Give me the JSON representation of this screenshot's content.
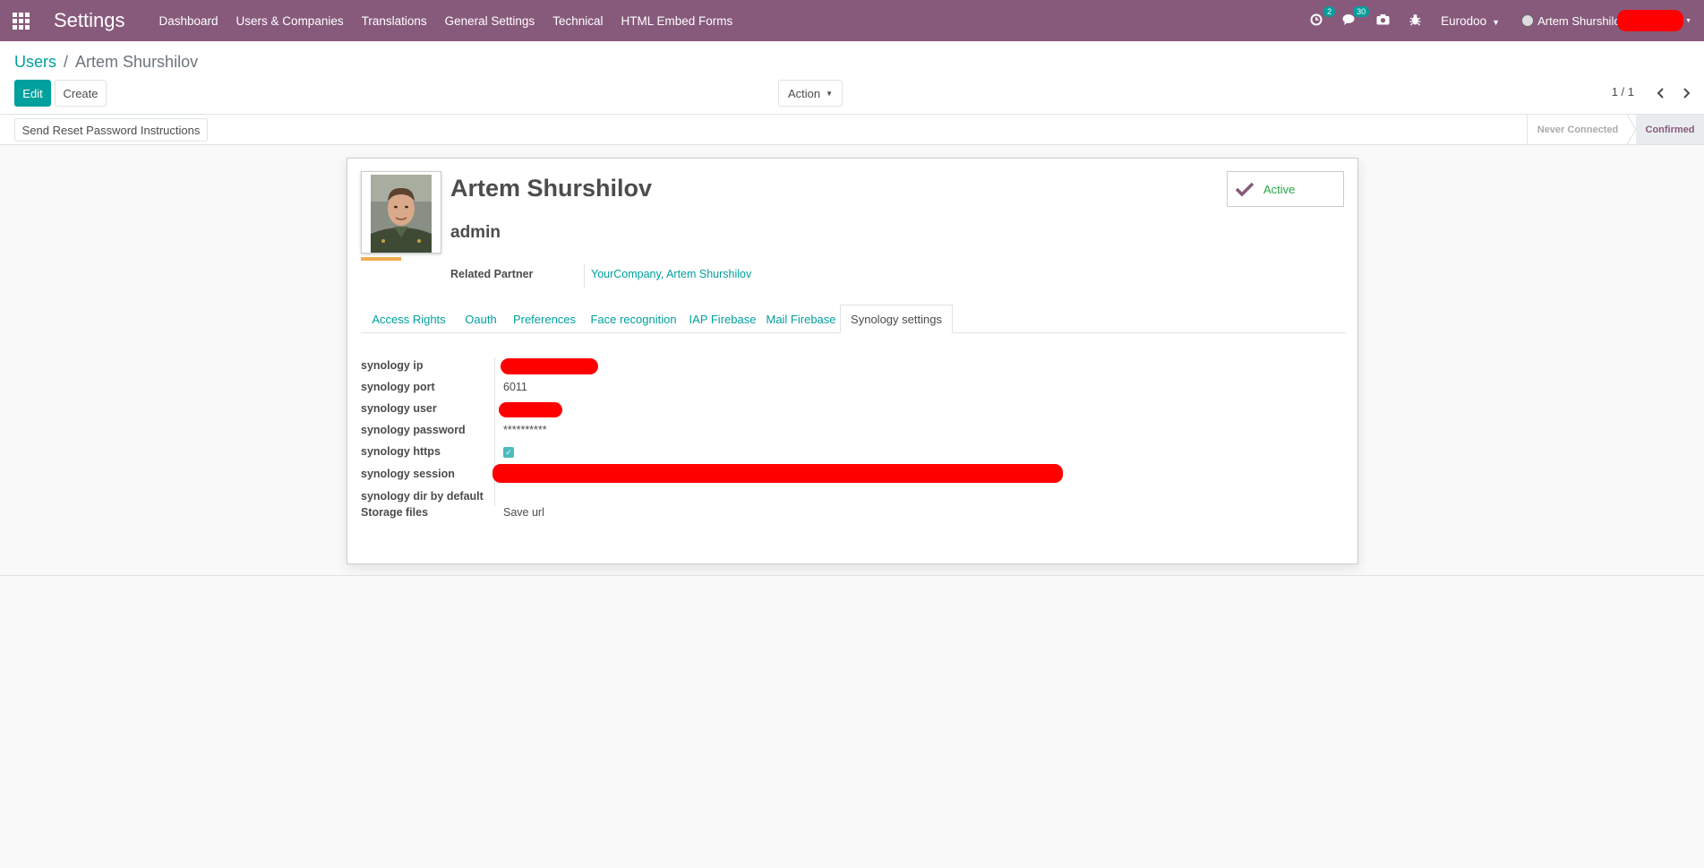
{
  "navbar": {
    "app_title": "Settings",
    "menu": [
      "Dashboard",
      "Users & Companies",
      "Translations",
      "General Settings",
      "Technical",
      "HTML Embed Forms"
    ],
    "activity_badge": "2",
    "messages_badge": "30",
    "company": "Eurodoo",
    "user": "Artem Shurshilov"
  },
  "control_panel": {
    "breadcrumb_parent": "Users",
    "breadcrumb_sep": "/",
    "breadcrumb_current": "Artem Shurshilov",
    "edit_label": "Edit",
    "create_label": "Create",
    "action_label": "Action",
    "pager": "1 / 1"
  },
  "statusbar": {
    "reset_password_label": "Send Reset Password Instructions",
    "stages": [
      "Never Connected",
      "Confirmed"
    ],
    "active_stage": "Confirmed"
  },
  "form": {
    "name": "Artem Shurshilov",
    "login": "admin",
    "active_label": "Active",
    "related_partner_label": "Related Partner",
    "related_partner_value": "YourCompany, Artem Shurshilov",
    "tabs": [
      "Access Rights",
      "Oauth",
      "Preferences",
      "Face recognition",
      "IAP Firebase",
      "Mail Firebase",
      "Synology settings"
    ],
    "active_tab": "Synology settings",
    "fields": {
      "ip_label": "synology ip",
      "port_label": "synology port",
      "port_value": "6011",
      "user_label": "synology user",
      "password_label": "synology password",
      "password_value": "**********",
      "https_label": "synology https",
      "https_checked": true,
      "session_label": "synology session",
      "dir_label": "synology dir by default",
      "storage_label": "Storage files",
      "storage_value": "Save url"
    }
  },
  "colors": {
    "brand": "#875a7b",
    "accent": "#00a09d",
    "success": "#28a745",
    "redaction": "#ff0000"
  }
}
